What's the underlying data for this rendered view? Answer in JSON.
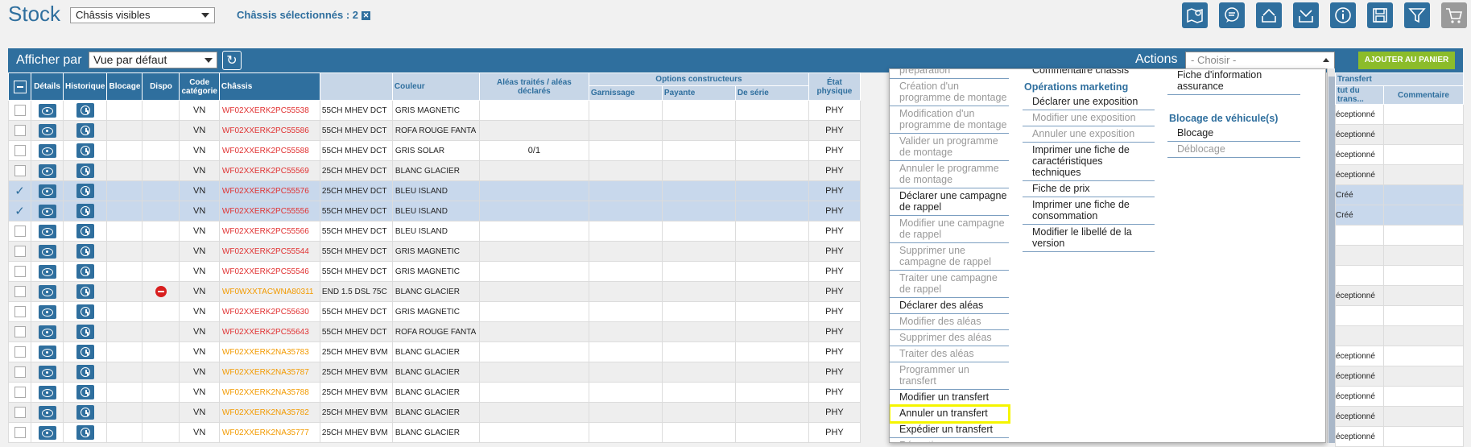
{
  "header": {
    "title": "Stock",
    "filter_select": "Châssis visibles",
    "selected_label": "Châssis sélectionnés : 2",
    "clear_icon": "x-icon"
  },
  "toolbar": {
    "icons": [
      "map-pin-icon",
      "chat-icon",
      "upload-icon",
      "download-icon",
      "info-icon",
      "save-icon",
      "filter-icon",
      "cart-icon"
    ]
  },
  "bar": {
    "afficher_label": "Afficher par",
    "view_select": "Vue par défaut",
    "actions_label": "Actions",
    "actions_select": "- Choisir -",
    "add_cart": "AJOUTER AU PANIER"
  },
  "columns": {
    "details": "Détails",
    "historique": "Historique",
    "blocage": "Blocage",
    "dispo": "Dispo",
    "code": "Code catégorie",
    "chassis": "Châssis",
    "couleur": "Couleur",
    "aleas": "Aléas traités / aléas déclarés",
    "options": "Options constructeurs",
    "garnissage": "Garnissage",
    "payante": "Payante",
    "serie": "De série",
    "etat": "État physique",
    "transfert": "Transfert",
    "statut": "tut du trans...",
    "commentaire": "Commentaire"
  },
  "rows": [
    {
      "checked": false,
      "dispo": "",
      "code": "VN",
      "chassis": "WF02XXERK2PC55538",
      "chassis_color": "red",
      "modele": "55CH MHEV DCT",
      "couleur": "GRIS MAGNETIC",
      "aleas": "",
      "etat": "PHY",
      "statut": "éceptionné",
      "hl": false
    },
    {
      "checked": false,
      "dispo": "",
      "code": "VN",
      "chassis": "WF02XXERK2PC55586",
      "chassis_color": "red",
      "modele": "55CH MHEV DCT",
      "couleur": "ROFA ROUGE FANTA",
      "aleas": "",
      "etat": "PHY",
      "statut": "éceptionné",
      "hl": false
    },
    {
      "checked": false,
      "dispo": "",
      "code": "VN",
      "chassis": "WF02XXERK2PC55588",
      "chassis_color": "red",
      "modele": "55CH MHEV DCT",
      "couleur": "GRIS SOLAR",
      "aleas": "0/1",
      "etat": "PHY",
      "statut": "éceptionné",
      "hl": false
    },
    {
      "checked": false,
      "dispo": "",
      "code": "VN",
      "chassis": "WF02XXERK2PC55569",
      "chassis_color": "red",
      "modele": "25CH MHEV DCT",
      "couleur": "BLANC GLACIER",
      "aleas": "",
      "etat": "PHY",
      "statut": "éceptionné",
      "hl": false
    },
    {
      "checked": true,
      "dispo": "",
      "code": "VN",
      "chassis": "WF02XXERK2PC55576",
      "chassis_color": "red",
      "modele": "25CH MHEV DCT",
      "couleur": "BLEU ISLAND",
      "aleas": "",
      "etat": "PHY",
      "statut": "Créé",
      "hl": true
    },
    {
      "checked": true,
      "dispo": "",
      "code": "VN",
      "chassis": "WF02XXERK2PC55556",
      "chassis_color": "red",
      "modele": "55CH MHEV DCT",
      "couleur": "BLEU ISLAND",
      "aleas": "",
      "etat": "PHY",
      "statut": "Créé",
      "hl": true
    },
    {
      "checked": false,
      "dispo": "",
      "code": "VN",
      "chassis": "WF02XXERK2PC55566",
      "chassis_color": "red",
      "modele": "55CH MHEV DCT",
      "couleur": "BLEU ISLAND",
      "aleas": "",
      "etat": "PHY",
      "statut": "",
      "hl": false
    },
    {
      "checked": false,
      "dispo": "",
      "code": "VN",
      "chassis": "WF02XXERK2PC55544",
      "chassis_color": "red",
      "modele": "55CH MHEV DCT",
      "couleur": "GRIS MAGNETIC",
      "aleas": "",
      "etat": "PHY",
      "statut": "",
      "hl": false
    },
    {
      "checked": false,
      "dispo": "",
      "code": "VN",
      "chassis": "WF02XXERK2PC55546",
      "chassis_color": "red",
      "modele": "55CH MHEV DCT",
      "couleur": "GRIS MAGNETIC",
      "aleas": "",
      "etat": "PHY",
      "statut": "",
      "hl": false
    },
    {
      "checked": false,
      "dispo": "no-entry-icon",
      "code": "VN",
      "chassis": "WF0WXXTACWNA80311",
      "chassis_color": "orange",
      "modele": "END 1.5 DSL 75C",
      "couleur": "BLANC GLACIER",
      "aleas": "",
      "etat": "PHY",
      "statut": "éceptionné",
      "hl": false
    },
    {
      "checked": false,
      "dispo": "",
      "code": "VN",
      "chassis": "WF02XXERK2PC55630",
      "chassis_color": "red",
      "modele": "55CH MHEV DCT",
      "couleur": "GRIS MAGNETIC",
      "aleas": "",
      "etat": "PHY",
      "statut": "",
      "hl": false
    },
    {
      "checked": false,
      "dispo": "",
      "code": "VN",
      "chassis": "WF02XXERK2PC55643",
      "chassis_color": "red",
      "modele": "55CH MHEV DCT",
      "couleur": "ROFA ROUGE FANTA",
      "aleas": "",
      "etat": "PHY",
      "statut": "",
      "hl": false
    },
    {
      "checked": false,
      "dispo": "",
      "code": "VN",
      "chassis": "WF02XXERK2NA35783",
      "chassis_color": "orange",
      "modele": "25CH MHEV BVM",
      "couleur": "BLANC GLACIER",
      "aleas": "",
      "etat": "PHY",
      "statut": "éceptionné",
      "hl": false
    },
    {
      "checked": false,
      "dispo": "",
      "code": "VN",
      "chassis": "WF02XXERK2NA35787",
      "chassis_color": "orange",
      "modele": "25CH MHEV BVM",
      "couleur": "BLANC GLACIER",
      "aleas": "",
      "etat": "PHY",
      "statut": "éceptionné",
      "hl": false
    },
    {
      "checked": false,
      "dispo": "",
      "code": "VN",
      "chassis": "WF02XXERK2NA35788",
      "chassis_color": "orange",
      "modele": "25CH MHEV BVM",
      "couleur": "BLANC GLACIER",
      "aleas": "",
      "etat": "PHY",
      "statut": "éceptionné",
      "hl": false
    },
    {
      "checked": false,
      "dispo": "",
      "code": "VN",
      "chassis": "WF02XXERK2NA35782",
      "chassis_color": "orange",
      "modele": "25CH MHEV BVM",
      "couleur": "BLANC GLACIER",
      "aleas": "",
      "etat": "PHY",
      "statut": "éceptionné",
      "hl": false
    },
    {
      "checked": false,
      "dispo": "",
      "code": "VN",
      "chassis": "WF02XXERK2NA35777",
      "chassis_color": "orange",
      "modele": "25CH MHEV BVM",
      "couleur": "BLANC GLACIER",
      "aleas": "",
      "etat": "PHY",
      "statut": "éceptionné",
      "hl": false
    }
  ],
  "dropdown": {
    "col1": [
      {
        "label": "préparation",
        "disabled": true
      },
      {
        "label": "Création d'un programme de montage",
        "disabled": true
      },
      {
        "label": "Modification d'un programme de montage",
        "disabled": true
      },
      {
        "label": "Valider un programme de montage",
        "disabled": true
      },
      {
        "label": "Annuler le programme de montage",
        "disabled": true
      },
      {
        "label": "Déclarer une campagne de rappel",
        "disabled": false
      },
      {
        "label": "Modifier une campagne de rappel",
        "disabled": true
      },
      {
        "label": "Supprimer une campagne de rappel",
        "disabled": true
      },
      {
        "label": "Traiter une campagne de rappel",
        "disabled": true
      },
      {
        "label": "Déclarer des aléas",
        "disabled": false
      },
      {
        "label": "Modifier des aléas",
        "disabled": true
      },
      {
        "label": "Supprimer des aléas",
        "disabled": true
      },
      {
        "label": "Traiter des aléas",
        "disabled": true
      },
      {
        "label": "Programmer un transfert",
        "disabled": true
      },
      {
        "label": "Modifier un transfert",
        "disabled": false
      },
      {
        "label": "Annuler un transfert",
        "disabled": false,
        "highlighted": true
      },
      {
        "label": "Expédier un transfert",
        "disabled": false
      },
      {
        "label": "Réceptionner un transfert",
        "disabled": true
      }
    ],
    "col2_top": "Commentaire châssis",
    "col2_heading": "Opérations marketing",
    "col2": [
      {
        "label": "Déclarer une exposition",
        "disabled": false
      },
      {
        "label": "Modifier une exposition",
        "disabled": true
      },
      {
        "label": "Annuler une exposition",
        "disabled": true
      },
      {
        "label": "Imprimer une fiche de caractéristiques techniques",
        "disabled": false
      },
      {
        "label": "Fiche de prix",
        "disabled": false
      },
      {
        "label": "Imprimer une fiche de consommation",
        "disabled": false
      },
      {
        "label": "Modifier le libellé de la version",
        "disabled": false
      }
    ],
    "col3_top": "Fiche d'information assurance",
    "col3_heading": "Blocage de véhicule(s)",
    "col3": [
      {
        "label": "Blocage",
        "disabled": false
      },
      {
        "label": "Déblocage",
        "disabled": true
      }
    ]
  },
  "colors": {
    "primary": "#2f6f9e",
    "header_light": "#c7d6e7",
    "cart_green": "#8cbc2a",
    "chassis_red": "#e03232",
    "chassis_orange": "#f29a00",
    "highlight": "#f5f500"
  }
}
